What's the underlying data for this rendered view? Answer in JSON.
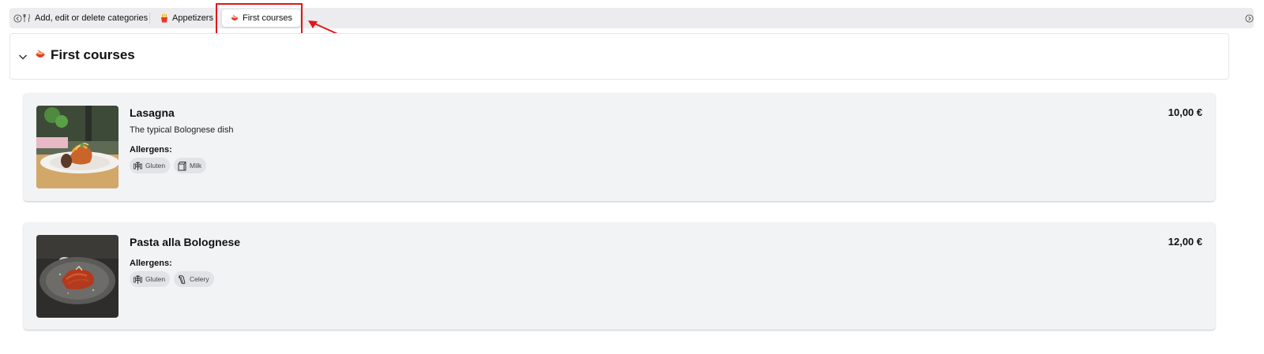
{
  "category_bar": {
    "items": [
      {
        "label": "Add, edit or delete categories",
        "icon": "cutlery-icon"
      },
      {
        "label": "Appetizers",
        "icon": "fries-icon"
      },
      {
        "label": "First courses",
        "icon": "pasta-bowl-icon",
        "selected": true
      }
    ],
    "scroll_left_icon": "chevron-left-circle-icon",
    "scroll_right_icon": "chevron-right-circle-icon"
  },
  "section": {
    "title": "First courses",
    "icon": "pasta-bowl-icon",
    "collapse_icon": "chevron-down-icon"
  },
  "dishes": [
    {
      "name": "Lasagna",
      "description": "The typical Bolognese dish",
      "price": "10,00 €",
      "allergens_label": "Allergens:",
      "allergens": [
        {
          "label": "Gluten",
          "icon": "wheat-icon"
        },
        {
          "label": "Milk",
          "icon": "milk-carton-icon"
        }
      ]
    },
    {
      "name": "Pasta alla Bolognese",
      "description": "",
      "price": "12,00 €",
      "allergens_label": "Allergens:",
      "allergens": [
        {
          "label": "Gluten",
          "icon": "wheat-icon"
        },
        {
          "label": "Celery",
          "icon": "celery-icon"
        }
      ]
    }
  ],
  "colors": {
    "highlight": "#e0161b",
    "card_background": "#f2f3f5",
    "bar_background": "#ececee",
    "chip_background": "#e2e3e6"
  }
}
